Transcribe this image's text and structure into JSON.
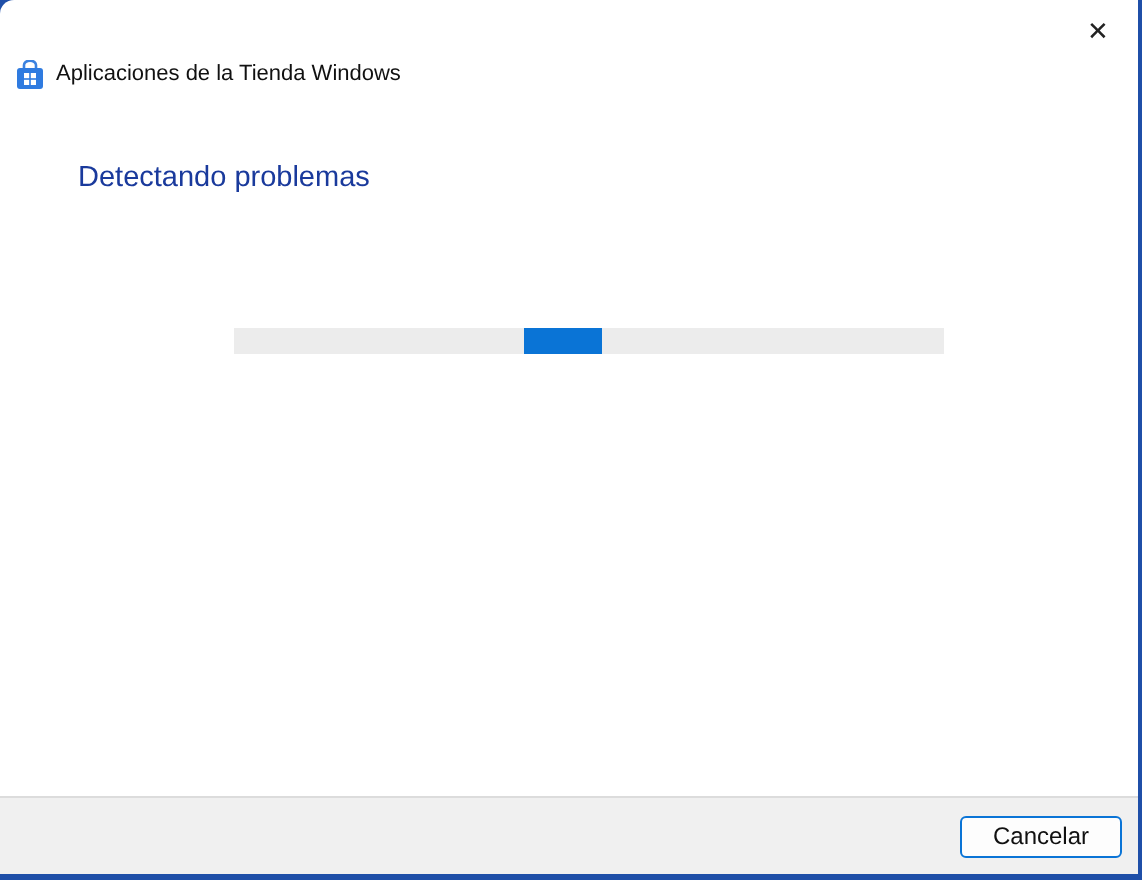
{
  "window": {
    "title": "Aplicaciones de la Tienda Windows",
    "close": "✕"
  },
  "heading": "Detectando problemas",
  "progress": {
    "indeterminate": true
  },
  "buttons": [
    {
      "label": "Cancelar",
      "focused": true
    }
  ]
}
